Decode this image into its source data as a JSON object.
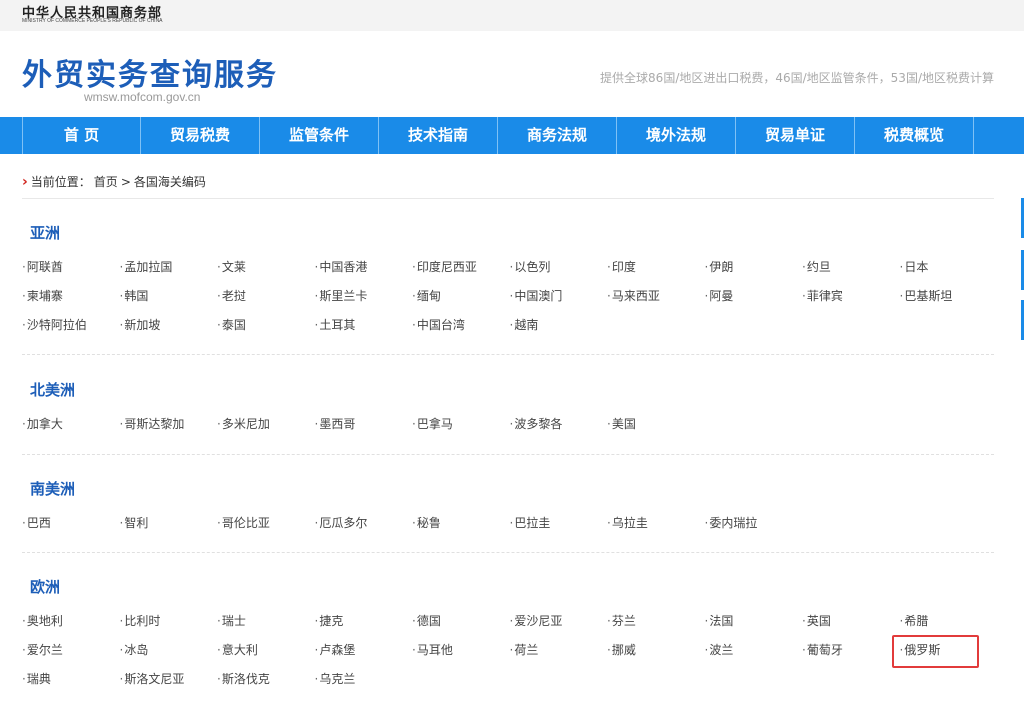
{
  "header": {
    "ministry_cn": "中华人民共和国商务部",
    "ministry_en": "MINISTRY OF COMMERCE PEOPLE'S REPUBLIC OF CHINA",
    "site_title": "外贸实务查询服务",
    "site_domain": "wmsw.mofcom.gov.cn",
    "tagline": "提供全球86国/地区进出口税费，46国/地区监管条件，53国/地区税费计算"
  },
  "nav": {
    "items": [
      "首 页",
      "贸易税费",
      "监管条件",
      "技术指南",
      "商务法规",
      "境外法规",
      "贸易单证",
      "税费概览"
    ]
  },
  "breadcrumb": {
    "prefix": "当前位置：",
    "home": "首页",
    "separator": ">",
    "current": "各国海关编码"
  },
  "bullet": "·",
  "sections": [
    {
      "title": "亚洲",
      "countries": [
        "阿联酋",
        "孟加拉国",
        "文莱",
        "中国香港",
        "印度尼西亚",
        "以色列",
        "印度",
        "伊朗",
        "约旦",
        "日本",
        "柬埔寨",
        "韩国",
        "老挝",
        "斯里兰卡",
        "缅甸",
        "中国澳门",
        "马来西亚",
        "阿曼",
        "菲律宾",
        "巴基斯坦",
        "沙特阿拉伯",
        "新加坡",
        "泰国",
        "土耳其",
        "中国台湾",
        "越南"
      ]
    },
    {
      "title": "北美洲",
      "countries": [
        "加拿大",
        "哥斯达黎加",
        "多米尼加",
        "墨西哥",
        "巴拿马",
        "波多黎各",
        "美国"
      ]
    },
    {
      "title": "南美洲",
      "countries": [
        "巴西",
        "智利",
        "哥伦比亚",
        "厄瓜多尔",
        "秘鲁",
        "巴拉圭",
        "乌拉圭",
        "委内瑞拉"
      ]
    },
    {
      "title": "欧洲",
      "countries": [
        "奥地利",
        "比利时",
        "瑞士",
        "捷克",
        "德国",
        "爱沙尼亚",
        "芬兰",
        "法国",
        "英国",
        "希腊",
        "爱尔兰",
        "冰岛",
        "意大利",
        "卢森堡",
        "马耳他",
        "荷兰",
        "挪威",
        "波兰",
        "葡萄牙",
        "俄罗斯",
        "瑞典",
        "斯洛文尼亚",
        "斯洛伐克",
        "乌克兰"
      ],
      "highlighted": "俄罗斯"
    }
  ]
}
